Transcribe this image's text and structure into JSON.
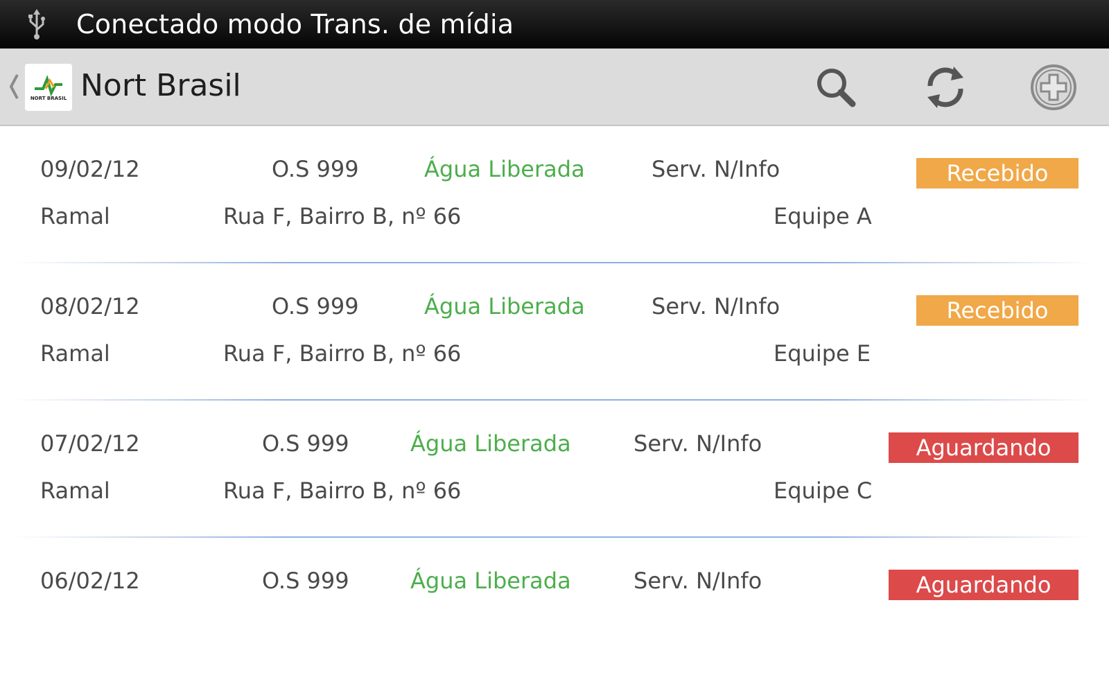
{
  "status_bar": {
    "text": "Conectado modo Trans. de mídia",
    "icon": "usb-icon"
  },
  "action_bar": {
    "title": "Nort Brasil",
    "logo_text": "NORT BRASIL",
    "icons": [
      "back-chevron-icon",
      "search-icon",
      "refresh-icon",
      "add-icon"
    ]
  },
  "colors": {
    "recebido": "#f0a848",
    "aguardando": "#dc4a4a",
    "green_text": "#4cae4c"
  },
  "items": [
    {
      "date": "09/02/12",
      "os": "O.S 999",
      "water": "Água Liberada",
      "serv": "Serv. N/Info",
      "status": "Recebido",
      "type": "Ramal",
      "address": "Rua F, Bairro B, nº 66",
      "team": "Equipe A"
    },
    {
      "date": "08/02/12",
      "os": "O.S 999",
      "water": "Água Liberada",
      "serv": "Serv. N/Info",
      "status": "Recebido",
      "type": "Ramal",
      "address": "Rua F, Bairro B, nº 66",
      "team": "Equipe E"
    },
    {
      "date": "07/02/12",
      "os": "O.S 999",
      "water": "Água Liberada",
      "serv": "Serv. N/Info",
      "status": "Aguardando",
      "type": "Ramal",
      "address": "Rua F, Bairro B, nº 66",
      "team": "Equipe C"
    },
    {
      "date": "06/02/12",
      "os": "O.S 999",
      "water": "Água Liberada",
      "serv": "Serv. N/Info",
      "status": "Aguardando"
    }
  ]
}
